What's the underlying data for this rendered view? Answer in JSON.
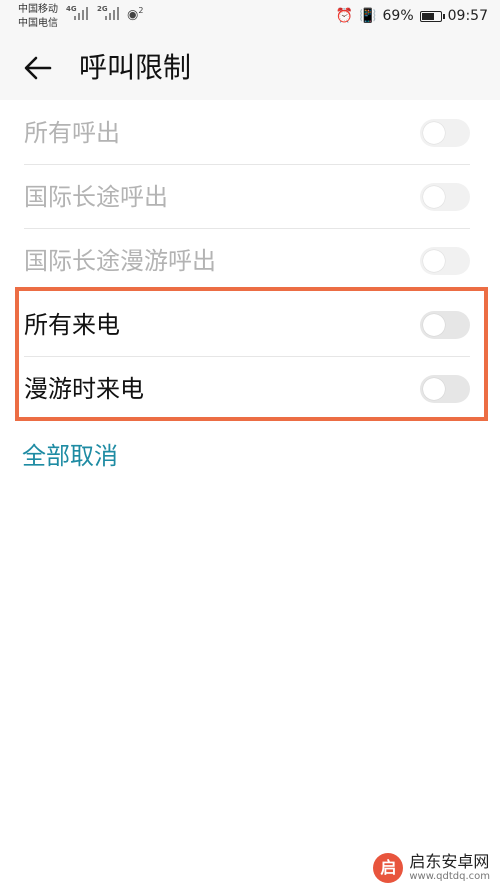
{
  "status_bar": {
    "carrier_1": "中国移动",
    "carrier_2": "中国电信",
    "net_1": "4G",
    "net_2": "2G",
    "hotspot_badge": "2",
    "battery": "69%",
    "battery_level": 0.69,
    "time": "09:57"
  },
  "app_bar": {
    "title": "呼叫限制"
  },
  "items": [
    {
      "label": "所有呼出",
      "enabled": false,
      "checked": false
    },
    {
      "label": "国际长途呼出",
      "enabled": false,
      "checked": false
    },
    {
      "label": "国际长途漫游呼出",
      "enabled": false,
      "checked": false
    },
    {
      "label": "所有来电",
      "enabled": true,
      "checked": false
    },
    {
      "label": "漫游时来电",
      "enabled": true,
      "checked": false
    }
  ],
  "actions": {
    "cancel_all": "全部取消"
  },
  "watermark": {
    "logo_char": "启",
    "name": "启东安卓网",
    "url": "www.qdtdq.com"
  },
  "colors": {
    "accent": "#1e8ba3",
    "highlight_border": "#ec6d44"
  }
}
